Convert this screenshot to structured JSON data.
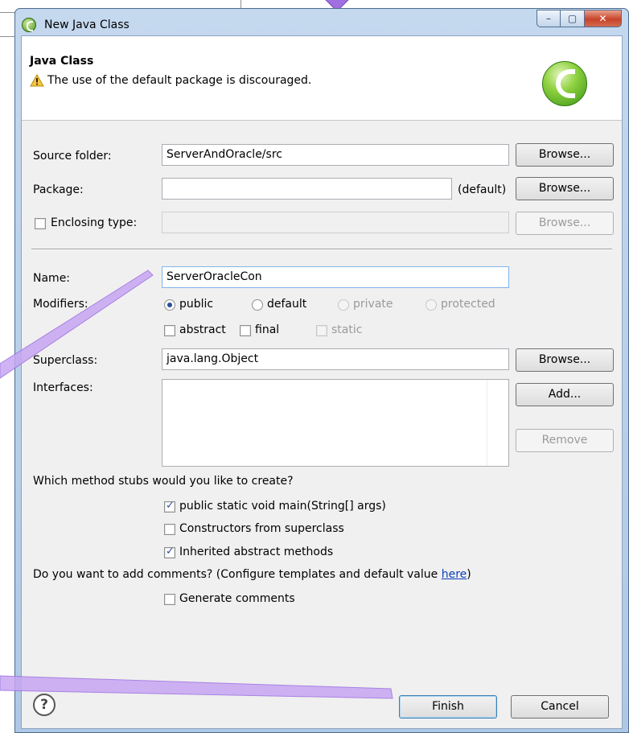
{
  "window": {
    "title": "New Java Class",
    "controls": {
      "minimize": "–",
      "maximize": "▢",
      "close": "✕"
    }
  },
  "header": {
    "title": "Java Class",
    "warning": "The use of the default package is discouraged."
  },
  "form": {
    "source_folder": {
      "label": "Source folder:",
      "value": "ServerAndOracle/src",
      "browse": "Browse..."
    },
    "package": {
      "label": "Package:",
      "value": "",
      "suffix": "(default)",
      "browse": "Browse..."
    },
    "enclosing_type": {
      "label": "Enclosing type:",
      "checked": false,
      "value": "",
      "browse": "Browse..."
    },
    "name": {
      "label": "Name:",
      "value": "ServerOracleCon"
    },
    "modifiers": {
      "label": "Modifiers:",
      "radios": [
        "public",
        "default",
        "private",
        "protected"
      ],
      "selected": "public",
      "checks": [
        "abstract",
        "final",
        "static"
      ]
    },
    "superclass": {
      "label": "Superclass:",
      "value": "java.lang.Object",
      "browse": "Browse..."
    },
    "interfaces": {
      "label": "Interfaces:",
      "add": "Add...",
      "remove": "Remove"
    }
  },
  "stubs": {
    "question": "Which method stubs would you like to create?",
    "options": [
      {
        "label": "public static void main(String[] args)",
        "checked": true
      },
      {
        "label": "Constructors from superclass",
        "checked": false
      },
      {
        "label": "Inherited abstract methods",
        "checked": true
      }
    ]
  },
  "comments": {
    "question": "Do you want to add comments? (Configure templates and default value ",
    "link": "here",
    "close": ")",
    "option": {
      "label": "Generate comments",
      "checked": false
    }
  },
  "footer": {
    "help": "?",
    "finish": "Finish",
    "cancel": "Cancel"
  },
  "colors": {
    "accent_purple": "#b58cf0",
    "window_frame": "#aec8e6",
    "link": "#0a3fbf"
  }
}
